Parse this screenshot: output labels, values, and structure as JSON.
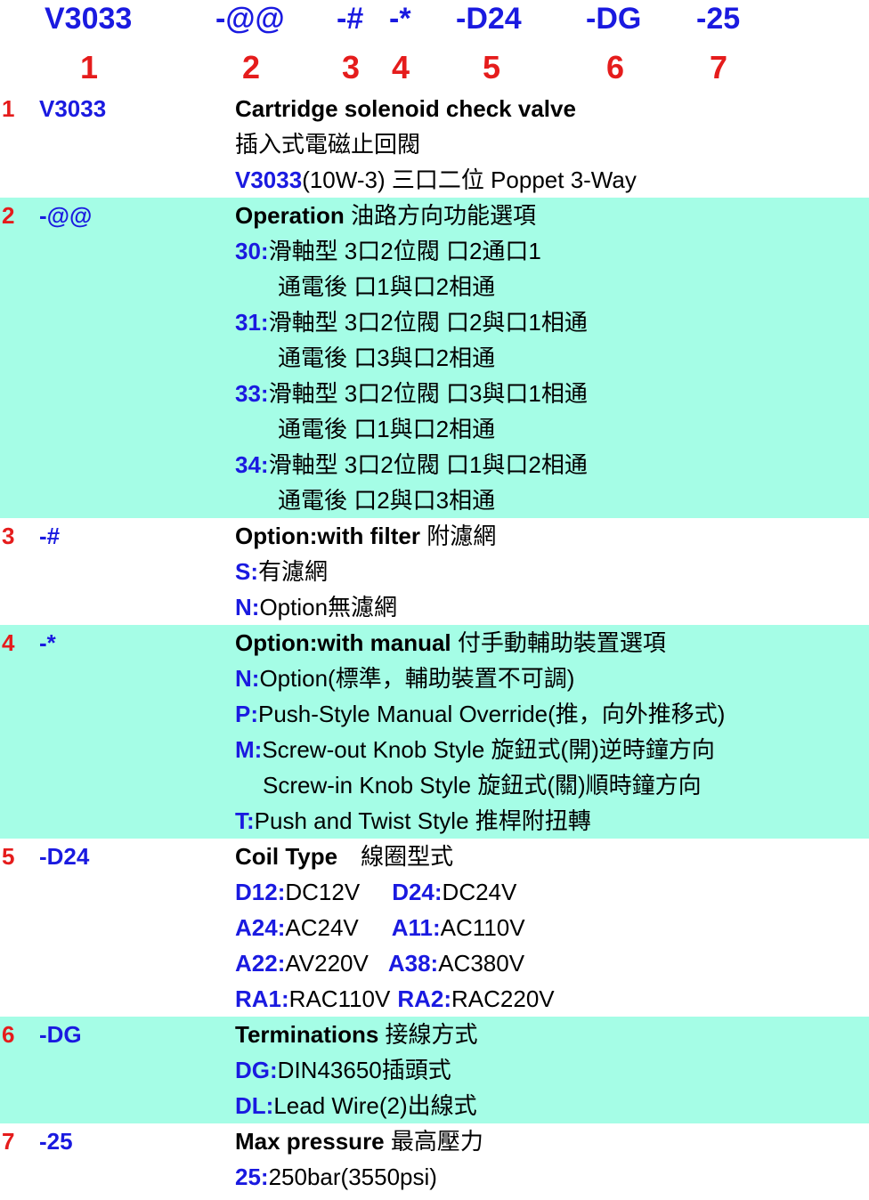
{
  "code_parts": [
    "V3033",
    "-@@",
    "-#",
    "-*",
    "-D24",
    "-DG",
    "-25"
  ],
  "numbers": [
    "1",
    "2",
    "3",
    "4",
    "5",
    "6",
    "7"
  ],
  "sections": {
    "s1": {
      "num": "1",
      "code": "V3033",
      "title": "Cartridge solenoid check valve",
      "l2": "插入式電磁止回閥",
      "l3k": "V3033",
      "l3": "(10W-3) 三口二位 Poppet 3-Way"
    },
    "s2": {
      "num": "2",
      "code": "-@@",
      "title": "Operation ",
      "title_cn": "油路方向功能選項",
      "o30k": "30:",
      "o30": "滑軸型 3口2位閥 口2通口1",
      "o30b": "通電後 口1與口2相通",
      "o31k": "31:",
      "o31": "滑軸型 3口2位閥 口2與口1相通",
      "o31b": "通電後 口3與口2相通",
      "o33k": "33:",
      "o33": "滑軸型 3口2位閥 口3與口1相通",
      "o33b": "通電後 口1與口2相通",
      "o34k": "34:",
      "o34": "滑軸型 3口2位閥 口1與口2相通",
      "o34b": "通電後 口2與口3相通"
    },
    "s3": {
      "num": "3",
      "code": "-#",
      "title": "Option:with filter ",
      "title_cn": "附濾網",
      "sk": "S:",
      "s": "有濾網",
      "nk": "N:",
      "n": "Option無濾網"
    },
    "s4": {
      "num": "4",
      "code": "-*",
      "title": "Option:with manual ",
      "title_cn": "付手動輔助裝置選項",
      "nk": "N:",
      "n": "Option(標準，輔助裝置不可調)",
      "pk": "P:",
      "p": "Push-Style Manual Override(推，向外推移式)",
      "mk": "M:",
      "m": "Screw-out Knob Style 旋鈕式(開)逆時鐘方向",
      "m2": "Screw-in Knob Style 旋鈕式(關)順時鐘方向",
      "tk": "T:",
      "t": "Push and Twist Style 推桿附扭轉"
    },
    "s5": {
      "num": "5",
      "code": "-D24",
      "title": "Coil Type",
      "title_cn": "線圈型式",
      "d12k": "D12:",
      "d12": "DC12V",
      "d24k": "D24:",
      "d24": "DC24V",
      "a24k": "A24:",
      "a24": "AC24V",
      "a11k": "A11:",
      "a11": "AC110V",
      "a22k": "A22:",
      "a22": "AV220V",
      "a38k": "A38:",
      "a38": "AC380V",
      "ra1k": "RA1:",
      "ra1": "RAC110V",
      "ra2k": "RA2:",
      "ra2": "RAC220V"
    },
    "s6": {
      "num": "6",
      "code": "-DG",
      "title": "Terminations ",
      "title_cn": "接線方式",
      "dgk": "DG:",
      "dg": "DIN43650插頭式",
      "dlk": "DL:",
      "dl": "Lead Wire(2)出線式"
    },
    "s7": {
      "num": "7",
      "code": "-25",
      "title": "Max pressure ",
      "title_cn": "最高壓力",
      "k": "25:",
      "v": "250bar(3550psi)"
    }
  }
}
